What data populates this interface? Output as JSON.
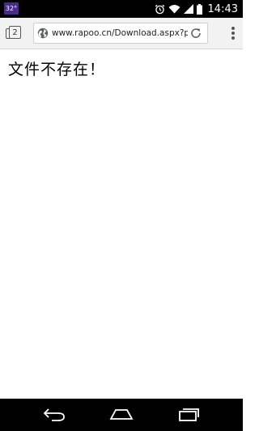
{
  "status_bar": {
    "weather_badge": "32°",
    "time": "14:43",
    "icons": [
      "alarm-icon",
      "wifi-icon",
      "signal-icon",
      "battery-icon"
    ]
  },
  "browser": {
    "tab_count": "2",
    "url": "www.rapoo.cn/Download.aspx?pi...",
    "icons": [
      "tab-switcher-icon",
      "globe-icon",
      "reload-icon",
      "overflow-menu-icon"
    ]
  },
  "page": {
    "message": "文件不存在！"
  },
  "nav_bar": {
    "icons": [
      "back-icon",
      "home-icon",
      "recents-icon"
    ]
  },
  "colors": {
    "status_bar_bg": "#000000",
    "toolbar_bg": "#f2f2f2",
    "weather_badge_bg": "#4a2a8c",
    "content_bg": "#ffffff"
  }
}
